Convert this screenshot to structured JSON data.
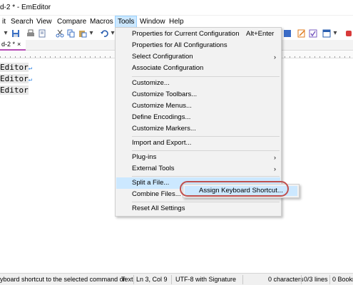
{
  "window": {
    "title": "d-2 * - EmEditor"
  },
  "menubar": {
    "items": [
      "it",
      "Search",
      "View",
      "Compare",
      "Macros",
      "Tools",
      "Window",
      "Help"
    ],
    "active": "Tools"
  },
  "toolbar": {
    "icons": [
      "dropdown-arrow-icon",
      "save-icon",
      "print-icon",
      "print-preview-icon",
      "cut-icon",
      "copy-icon",
      "paste-icon",
      "undo-icon"
    ]
  },
  "tab": {
    "label": "d-2 *",
    "close": "×"
  },
  "editor": {
    "lines": [
      "Editor",
      "Editor",
      "Editor"
    ],
    "eol_mark": "↵"
  },
  "tools_menu": {
    "items": [
      {
        "label": "Properties for Current Configuration",
        "shortcut": "Alt+Enter"
      },
      {
        "label": "Properties for All Configurations"
      },
      {
        "label": "Select Configuration",
        "arrow": "›"
      },
      {
        "label": "Associate Configuration"
      },
      {
        "label": "Customize..."
      },
      {
        "label": "Customize Toolbars..."
      },
      {
        "label": "Customize Menus..."
      },
      {
        "label": "Define Encodings..."
      },
      {
        "label": "Customize Markers..."
      },
      {
        "label": "Import and Export..."
      },
      {
        "label": "Plug-ins",
        "arrow": "›"
      },
      {
        "label": "External Tools",
        "arrow": "›"
      },
      {
        "label": "Split a File..."
      },
      {
        "label": "Combine Files..."
      },
      {
        "label": "Reset All Settings"
      }
    ]
  },
  "submenu": {
    "label": "Assign Keyboard Shortcut..."
  },
  "statusbar": {
    "message": "yboard shortcut to the selected command or",
    "mode": "Text",
    "position": "Ln 3, Col 9",
    "encoding": "UTF-8 with Signature",
    "chars": "0 characters",
    "lines": "0/3 lines",
    "bookmarks": "0 Bookm"
  }
}
